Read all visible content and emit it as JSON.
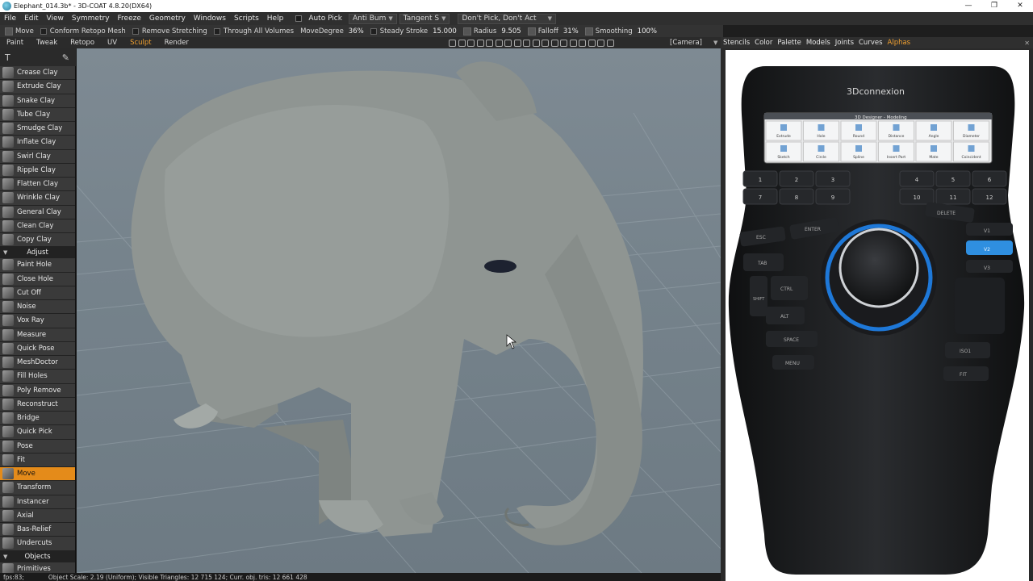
{
  "window": {
    "title": "Elephant_014.3b* - 3D-COAT 4.8.20(DX64)",
    "buttons": {
      "minimize": "—",
      "maximize": "❐",
      "close": "✕"
    }
  },
  "menu": {
    "items": [
      "File",
      "Edit",
      "View",
      "Symmetry",
      "Freeze",
      "Geometry",
      "Windows",
      "Scripts",
      "Help"
    ],
    "auto_pick": "Auto Pick",
    "anti_bump": "Anti Bum",
    "tangent": "Tangent S",
    "pick_mode": "Don't Pick, Don't Act"
  },
  "tool_options": {
    "move_label": "Move",
    "conform_retopo": "Conform Retopo Mesh",
    "remove_stretching": "Remove Stretching",
    "through_all_volumes": "Through  All  Volumes",
    "move_degree_label": "MoveDegree",
    "move_degree_value": "36%",
    "steady_stroke_label": "Steady Stroke",
    "steady_stroke_value": "15.000",
    "radius_label": "Radius",
    "radius_value": "9.505",
    "falloff_label": "Falloff",
    "falloff_value": "31%",
    "smoothing_label": "Smoothing",
    "smoothing_value": "100%"
  },
  "rooms": {
    "tabs": [
      "Paint",
      "Tweak",
      "Retopo",
      "UV",
      "Sculpt",
      "Render"
    ],
    "active": "Sculpt",
    "camera": "[Camera]"
  },
  "tool_panel": {
    "tools_a": [
      "Crease Clay",
      "Extrude Clay",
      "Snake Clay",
      "Tube Clay",
      "Smudge Clay",
      "Inflate Clay",
      "Swirl Clay",
      "Ripple Clay",
      "Flatten Clay",
      "Wrinkle Clay",
      "General Clay",
      "Clean Clay",
      "Copy Clay"
    ],
    "section_adjust": "Adjust",
    "tools_b": [
      "Paint Hole",
      "Close Hole",
      "Cut Off",
      "Noise",
      "Vox Ray",
      "Measure",
      "Quick Pose",
      "MeshDoctor",
      "Fill Holes",
      "Poly Remove",
      "Reconstruct",
      "Bridge",
      "Quick Pick",
      "Pose",
      "Fit",
      "Move",
      "Transform",
      "Instancer",
      "Axial",
      "Bas-Relief",
      "Undercuts"
    ],
    "active_tool": "Move",
    "section_objects": "Objects",
    "tools_c": [
      "Primitives"
    ]
  },
  "right_panel": {
    "tabs": [
      "Stencils",
      "Color",
      "Palette",
      "Models",
      "Joints",
      "Curves",
      "Alphas"
    ],
    "active": "Alphas",
    "device": {
      "brand": "3Dconnexion",
      "lcd_title": "3D Designer - Modeling",
      "lcd_buttons": [
        "Extrude",
        "Hole",
        "Round",
        "Distance",
        "Angle",
        "Diameter",
        "Sketch",
        "Circle",
        "Spline",
        "Insert Part",
        "Mate",
        "Coincident"
      ],
      "keys_left": [
        "1",
        "2",
        "3",
        "7",
        "8",
        "9"
      ],
      "keys_right": [
        "4",
        "5",
        "6",
        "10",
        "11",
        "12"
      ],
      "left_keys": [
        "ESC",
        "ENTER",
        "TAB",
        "SHIFT",
        "CTRL",
        "ALT",
        "SPACE",
        "MENU"
      ],
      "right_keys": [
        "DELETE",
        "V1",
        "V2",
        "V3",
        "ISO1",
        "FIT"
      ],
      "colors": {
        "body": "#1a1b1d",
        "accent_ring": "#1e78d8",
        "highlight_key": "#2f8fe0"
      }
    }
  },
  "status": {
    "fps": "fps:83;",
    "info": "Object Scale: 2.19 (Uniform); Visible Triangles: 12 715 124; Curr. obj. tris: 12 661 428"
  },
  "colors": {
    "active_tool": "#e48b1a",
    "active_room": "#f0a030",
    "viewport_bg": "#76838c",
    "elephant": "#8f9592"
  }
}
